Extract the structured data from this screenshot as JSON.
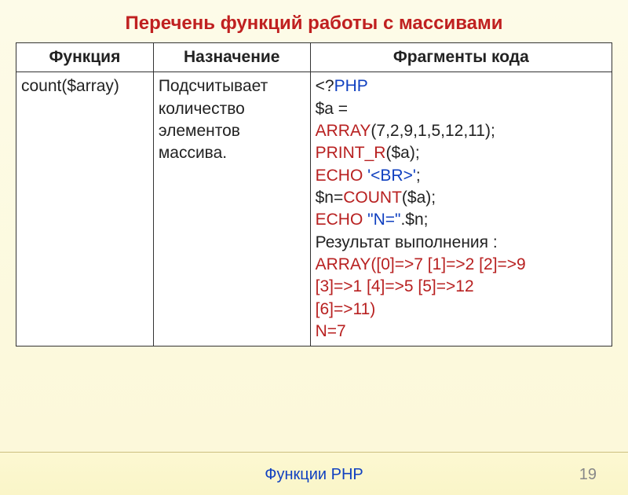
{
  "title": "Перечень функций работы с массивами",
  "headers": {
    "func": "Функция",
    "desc": "Назначение",
    "code": "Фрагменты кода"
  },
  "row": {
    "func": "count($array)",
    "desc": "Подсчитывает количество элементов массива.",
    "code": {
      "l1a": "<?",
      "l1b": "PHP",
      "l2": "$a =",
      "l3a": "ARRAY",
      "l3b": "(7,2,9,1,5,12,11);",
      "l4a": "PRINT_R",
      "l4b": "($a);",
      "l5a": "ECHO ",
      "l5b": "'<BR>'",
      "l5c": ";",
      "l6a": "$n=",
      "l6b": "COUNT",
      "l6c": "($a);",
      "l7a": "ECHO ",
      "l7b": "\"N=\"",
      "l7c": ".$n;",
      "res_label": "Результат выполнения :",
      "r1a": "ARRAY",
      "r1b": "([0]=>7 [1]=>2 [2]=>9",
      "r2": "[3]=>1 [4]=>5 [5]=>12",
      "r3": "[6]=>11)",
      "r4": "N=7"
    }
  },
  "footer": "Функции PHP",
  "page": "19"
}
